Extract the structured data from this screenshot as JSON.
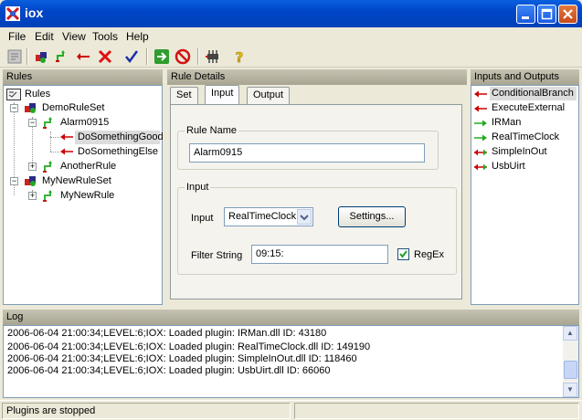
{
  "window": {
    "title": "iox"
  },
  "menu": [
    "File",
    "Edit",
    "View",
    "Tools",
    "Help"
  ],
  "toolbar": {
    "icons": [
      "properties-icon",
      "add-ruleset-icon",
      "add-rule-icon",
      "add-action-icon",
      "delete-icon",
      "check-icon",
      "run-icon",
      "stop-icon",
      "plugin-icon",
      "help-icon"
    ]
  },
  "rules_panel": {
    "title": "Rules",
    "tree": [
      {
        "label": "Rules",
        "level": 0
      },
      {
        "label": "DemoRuleSet",
        "level": 1
      },
      {
        "label": "Alarm0915",
        "level": 2
      },
      {
        "label": "DoSomethingGood",
        "level": 3
      },
      {
        "label": "DoSomethingElse",
        "level": 3
      },
      {
        "label": "AnotherRule",
        "level": 2
      },
      {
        "label": "MyNewRuleSet",
        "level": 1
      },
      {
        "label": "MyNewRule",
        "level": 2
      }
    ]
  },
  "details": {
    "title": "Rule Details",
    "tabs": [
      "Set",
      "Input",
      "Output"
    ],
    "active_tab": "Input",
    "rule_name_group": "Rule Name",
    "rule_name_value": "Alarm0915",
    "input_group": "Input",
    "input_label": "Input",
    "input_select_value": "RealTimeClock",
    "settings_button": "Settings...",
    "filter_label": "Filter String",
    "filter_value": "09:15:",
    "regex_label": "RegEx",
    "regex_checked": true
  },
  "io_panel": {
    "title": "Inputs and Outputs",
    "items": [
      {
        "label": "ConditionalBranch",
        "kind": "output",
        "color": "#cc0000"
      },
      {
        "label": "ExecuteExternal",
        "kind": "output",
        "color": "#cc0000"
      },
      {
        "label": "IRMan",
        "kind": "input",
        "color": "#22aa22"
      },
      {
        "label": "RealTimeClock",
        "kind": "input",
        "color": "#22aa22"
      },
      {
        "label": "SimpleInOut",
        "kind": "both",
        "color": "#cc0000"
      },
      {
        "label": "UsbUirt",
        "kind": "both",
        "color": "#cc0000"
      }
    ]
  },
  "log": {
    "title": "Log",
    "lines": [
      "2006-06-04 21:00:34;LEVEL:6;IOX: Loaded plugin: IRMan.dll  ID: 43180",
      "2006-06-04 21:00:34;LEVEL:6;IOX: Loaded plugin: RealTimeClock.dll  ID: 149190",
      "2006-06-04 21:00:34;LEVEL:6;IOX: Loaded plugin: SimpleInOut.dll  ID: 118460",
      "2006-06-04 21:00:34;LEVEL:6;IOX: Loaded plugin: UsbUirt.dll  ID: 66060"
    ]
  },
  "status": {
    "text": "Plugins are stopped"
  }
}
